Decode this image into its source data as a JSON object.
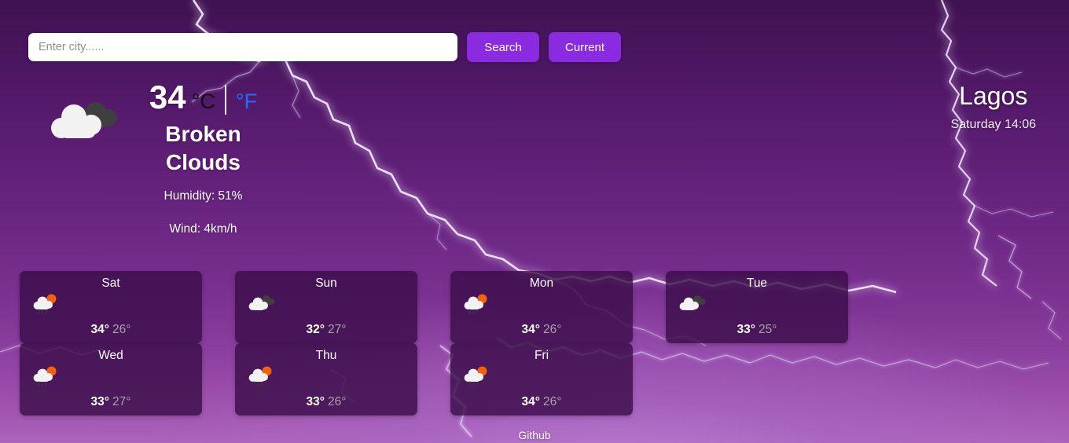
{
  "search": {
    "placeholder": "Enter city......",
    "value": "",
    "search_label": "Search",
    "current_label": "Current"
  },
  "current": {
    "icon": "broken-clouds-icon",
    "temperature": "34",
    "unit_celsius": "°C",
    "unit_fahrenheit": "°F",
    "active_unit": "celsius",
    "description": "Broken Clouds",
    "humidity": "Humidity: 51%",
    "wind": "Wind: 4km/h",
    "city": "Lagos",
    "datetime": "Saturday 14:06"
  },
  "forecast": [
    {
      "day": "Sat",
      "icon": "sun-cloud-rain-icon",
      "high": "34°",
      "low": "26°"
    },
    {
      "day": "Sun",
      "icon": "broken-clouds-icon",
      "high": "32°",
      "low": "27°"
    },
    {
      "day": "Mon",
      "icon": "sun-cloud-rain-icon",
      "high": "34°",
      "low": "26°"
    },
    {
      "day": "Tue",
      "icon": "broken-clouds-icon",
      "high": "33°",
      "low": "25°"
    },
    {
      "day": "Wed",
      "icon": "sun-cloud-rain-icon",
      "high": "33°",
      "low": "27°"
    },
    {
      "day": "Thu",
      "icon": "sun-cloud-rain-icon",
      "high": "33°",
      "low": "26°"
    },
    {
      "day": "Fri",
      "icon": "sun-cloud-rain-icon",
      "high": "34°",
      "low": "26°"
    }
  ],
  "footer": {
    "github_label": "Github"
  },
  "colors": {
    "accent_button": "#8a2be2",
    "card_background": "#3a0e49",
    "unit_celsius_active": "#111111",
    "unit_fahrenheit_inactive": "#1e6fff",
    "low_temp": "#a9a0ad",
    "sun": "#f4600f",
    "cloud_light": "#f2f2f2",
    "cloud_dark": "#3f3f3f"
  }
}
